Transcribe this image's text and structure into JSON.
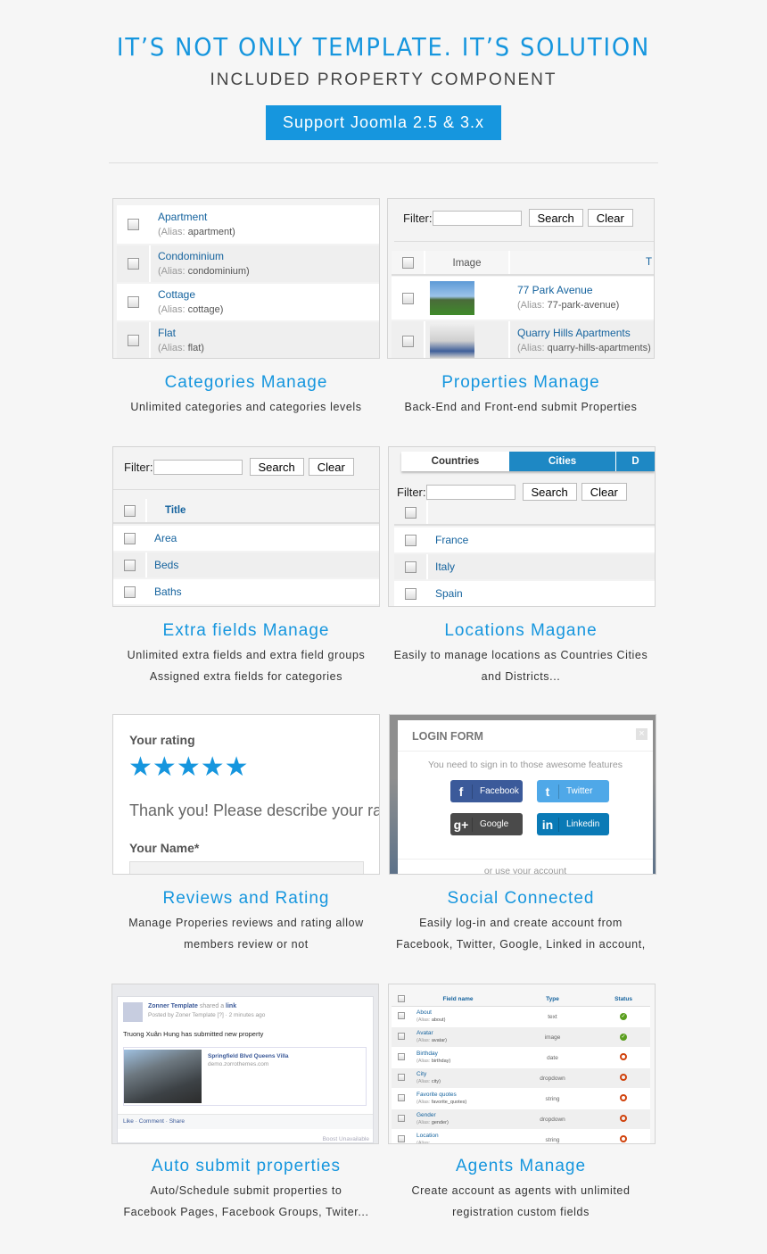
{
  "header": {
    "title": "IT’S NOT ONLY TEMPLATE. IT’S SOLUTION",
    "subtitle": "INCLUDED PROPERTY COMPONENT",
    "button": "Support Joomla 2.5 & 3.x"
  },
  "colors": {
    "accent": "#1696de",
    "link": "#15639e"
  },
  "features": [
    {
      "title": "Categories Manage",
      "desc": [
        "Unlimited categories and categories levels"
      ]
    },
    {
      "title": "Properties Manage",
      "desc": [
        "Back-End and Front-end submit Properties"
      ]
    },
    {
      "title": "Extra fields Manage",
      "desc": [
        "Unlimited extra fields and extra field groups",
        "Assigned extra fields for categories"
      ]
    },
    {
      "title": "Locations Magane",
      "desc": [
        "Easily to manage locations as Countries  Cities",
        "and Districts..."
      ]
    },
    {
      "title": "Reviews and Rating",
      "desc": [
        "Manage Properies reviews and rating allow",
        "members review or not"
      ]
    },
    {
      "title": "Social Connected",
      "desc": [
        "Easily log-in and create account from",
        "Facebook, Twitter, Google, Linked in account,"
      ]
    },
    {
      "title": "Auto submit properties",
      "desc": [
        "Auto/Schedule submit properties to",
        "Facebook Pages, Facebook Groups, Twiter..."
      ]
    },
    {
      "title": "Agents Manage",
      "desc": [
        "Create account as agents with unlimited",
        "registration custom fields"
      ]
    }
  ],
  "categories": {
    "alias_label": "(Alias:",
    "items": [
      {
        "name": "Apartment",
        "alias": "apartment)"
      },
      {
        "name": "Condominium",
        "alias": "condominium)"
      },
      {
        "name": "Cottage",
        "alias": "cottage)"
      },
      {
        "name": "Flat",
        "alias": "flat)"
      }
    ]
  },
  "filter": {
    "label": "Filter:",
    "search": "Search",
    "clear": "Clear",
    "value": ""
  },
  "properties": {
    "col_image": "Image",
    "col_title": "T",
    "items": [
      {
        "name": "77 Park Avenue",
        "alias": "77-park-avenue)"
      },
      {
        "name": "Quarry Hills Apartments",
        "alias": "quarry-hills-apartments)"
      }
    ]
  },
  "extra_fields": {
    "col_title": "Title",
    "items": [
      "Area",
      "Beds",
      "Baths"
    ]
  },
  "locations": {
    "tabs": [
      "Countries",
      "Cities",
      "D"
    ],
    "items": [
      "France",
      "Italy",
      "Spain"
    ]
  },
  "reviews": {
    "label": "Your rating",
    "rating": 5,
    "max": 5,
    "thanks": "Thank you! Please describe your rati",
    "name_label": "Your Name",
    "required": "*"
  },
  "login": {
    "title": "LOGIN FORM",
    "close": "×",
    "prompt": "You need to sign in to those awesome features",
    "buttons": [
      {
        "label": "Facebook",
        "icon": "f",
        "color": "#3b5a9a"
      },
      {
        "label": "Twitter",
        "icon": "t",
        "color": "#4fa8e8"
      },
      {
        "label": "Google",
        "icon": "g+",
        "color": "#4a4a4a"
      },
      {
        "label": "Linkedin",
        "icon": "in",
        "color": "#0a7ab6"
      }
    ],
    "alt": "or use your account"
  },
  "facebook_post": {
    "page": "Zonner Template",
    "shared": "shared a",
    "link": "link",
    "meta": "Posted by Zoner Template [?] · 2 minutes ago",
    "text": "Truong Xuân Hung has submitted new property",
    "card_title": "Springfield Blvd Queens Villa",
    "card_url": "demo.zorrothemes.com",
    "actions": [
      "Like",
      "Comment",
      "Share"
    ],
    "boost": "Boost Unavailable"
  },
  "agents": {
    "columns": [
      "Field name",
      "Type",
      "Status"
    ],
    "alias_label": "(Alias:",
    "rows": [
      {
        "name": "About",
        "alias": "about)",
        "type": "text",
        "published": true
      },
      {
        "name": "Avatar",
        "alias": "avatar)",
        "type": "image",
        "published": true
      },
      {
        "name": "Birthday",
        "alias": "birthday)",
        "type": "date",
        "published": false
      },
      {
        "name": "City",
        "alias": "city)",
        "type": "dropdown",
        "published": false
      },
      {
        "name": "Favorite quotes",
        "alias": "favorite_quotes)",
        "type": "string",
        "published": false
      },
      {
        "name": "Gender",
        "alias": "gender)",
        "type": "dropdown",
        "published": false
      },
      {
        "name": "Location",
        "alias": "",
        "type": "string",
        "published": false
      }
    ]
  }
}
